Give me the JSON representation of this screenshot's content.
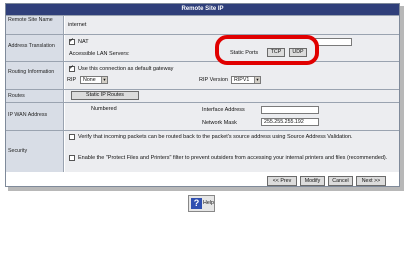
{
  "title": "Remote Site IP",
  "rows": {
    "name": {
      "label": "Remote Site Name",
      "value": "internet"
    },
    "address_translation": {
      "label": "Address Translation",
      "nat_label": "NAT",
      "accessible_label": "Accessible LAN Servers:",
      "static_ports_label": "Static Ports",
      "tcp_label": "TCP",
      "udp_label": "UDP"
    },
    "routing": {
      "label": "Routing Information",
      "default_gateway_label": "Use this connection as default gateway",
      "rip_label": "RIP",
      "rip_value": "None",
      "rip_version_label": "RIP Version",
      "rip_version_value": "RIPV1"
    },
    "routes": {
      "label": "Routes",
      "button_label": "Static IP Routes"
    },
    "wan": {
      "label": "IP WAN Address",
      "mode": "Numbered",
      "interface_label": "Interface Address",
      "interface_value": "",
      "mask_label": "Network Mask",
      "mask_value": "255.255.255.192"
    },
    "security": {
      "label": "Security",
      "verify_text": "Verify that incoming packets can be routed back to the packet's source address using Source Address Validation.",
      "protect_text": "Enable the \"Protect Files and Printers\" filter to prevent outsiders from accessing your internal printers and files (recommended)."
    }
  },
  "nav": {
    "prev": "<< Prev",
    "modify": "Modify",
    "cancel": "Cancel",
    "next": "Next >>"
  },
  "help": {
    "label": "Help",
    "icon": "question-icon"
  },
  "colors": {
    "titlebar": "#2f3f7a",
    "highlight": "#e00000",
    "label_bg": "#d8dde6"
  }
}
